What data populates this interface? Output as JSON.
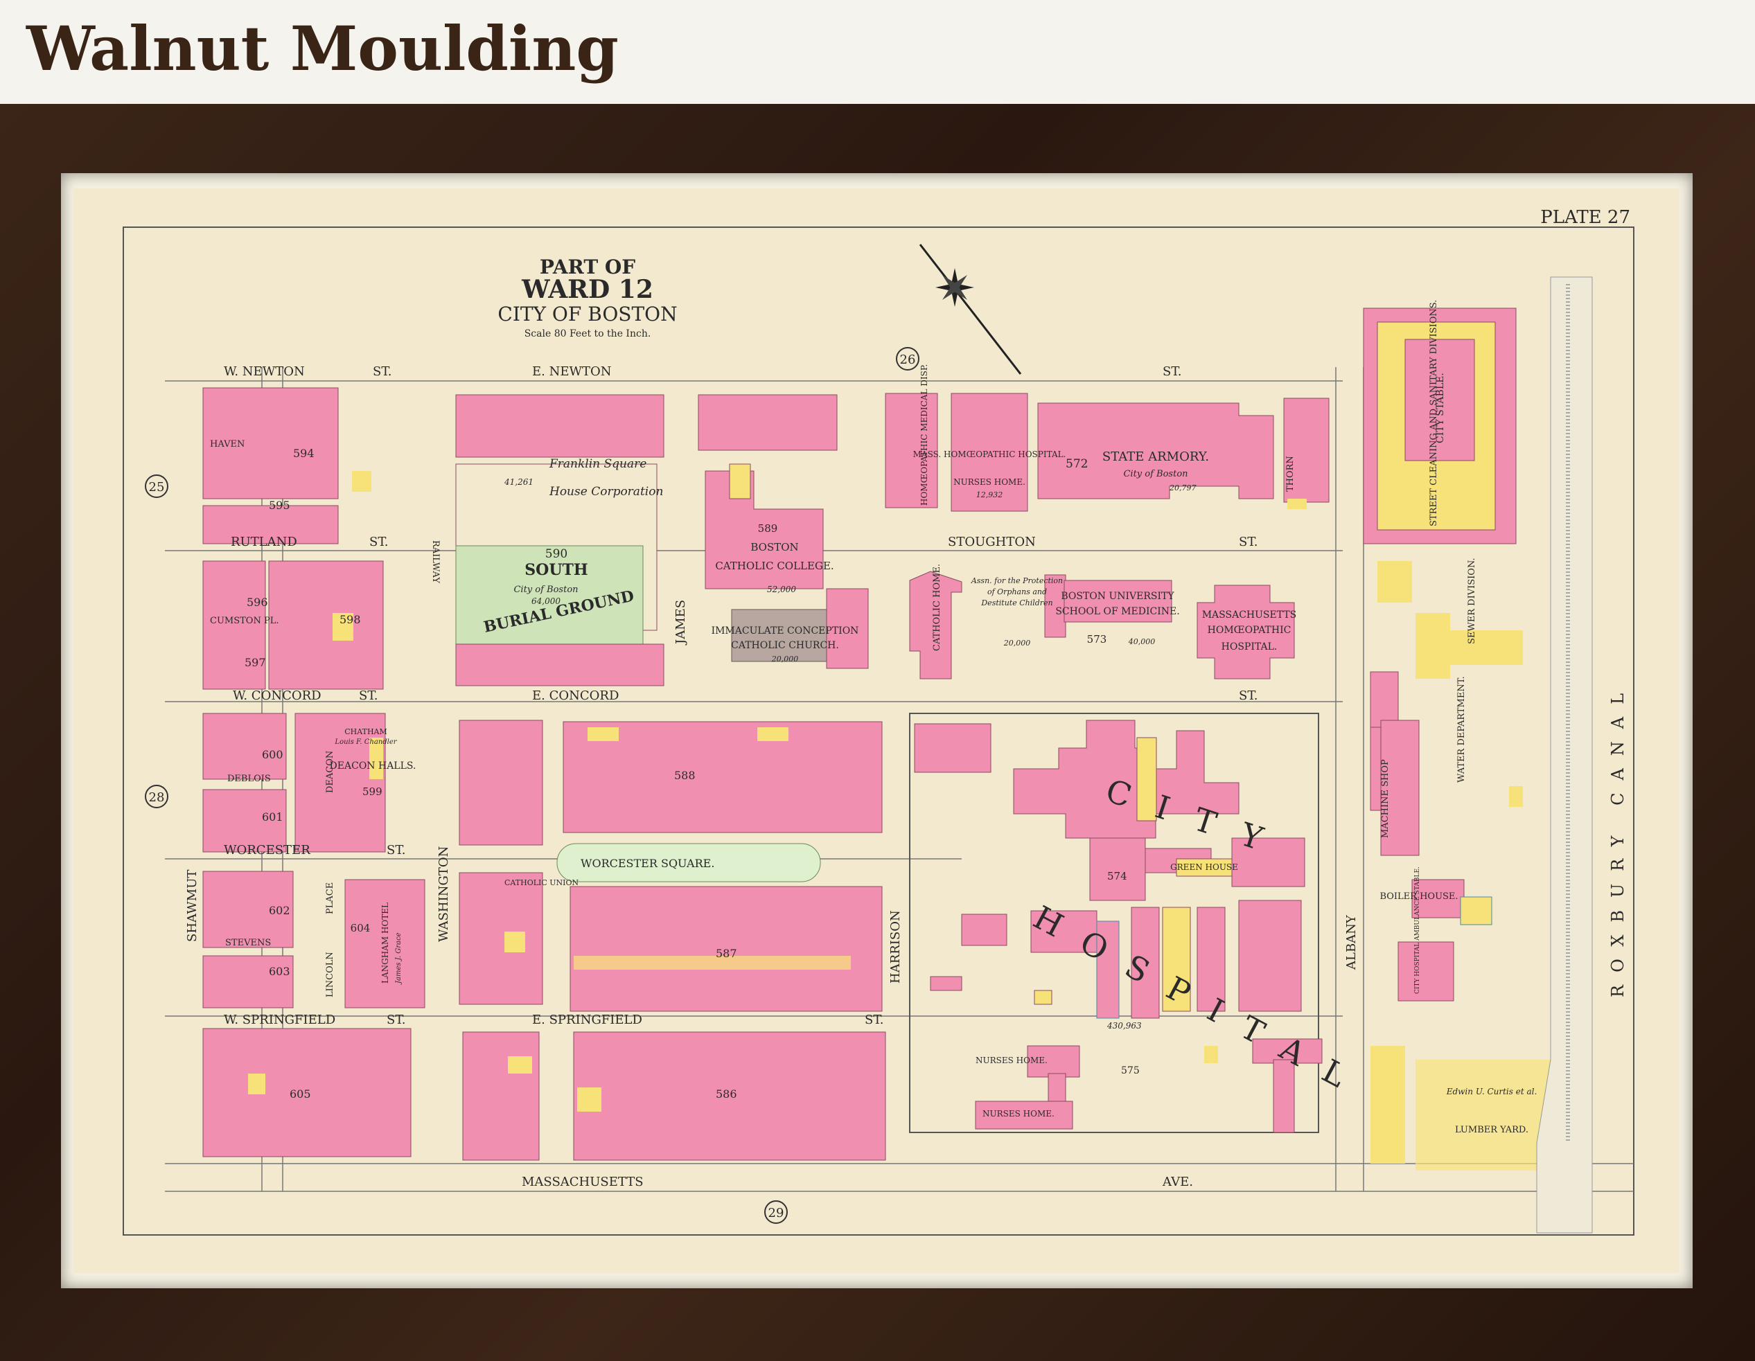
{
  "header": {
    "title": "Walnut Moulding"
  },
  "colors": {
    "frame": "#2f1c12",
    "paper": "#f3e9cf",
    "brick": "#f08fb0",
    "wood": "#f7e27a",
    "stone": "#b7a7a0",
    "park": "#cfe3b8",
    "ink": "#2a2a2a"
  },
  "map": {
    "plate": "PLATE 27",
    "title_lines": [
      "PART OF",
      "WARD 12",
      "CITY OF BOSTON",
      "Scale 80 Feet to the Inch."
    ],
    "adjacent_plates": [
      "25",
      "26",
      "28",
      "29"
    ],
    "streets": {
      "w_newton": "W. NEWTON",
      "st": "ST.",
      "e_newton": "E. NEWTON",
      "haven": "HAVEN",
      "rutland": "RUTLAND",
      "cumston_pl": "CUMSTON PL.",
      "w_concord": "W. CONCORD",
      "e_concord": "E. CONCORD",
      "deblois": "DEBLOIS",
      "worcester": "WORCESTER",
      "worcester_square": "WORCESTER SQUARE.",
      "w_springfield": "W. SPRINGFIELD",
      "e_springfield": "E. SPRINGFIELD",
      "stevens": "STEVENS",
      "massachusetts": "MASSACHUSETTS",
      "ave": "AVE.",
      "stoughton": "STOUGHTON",
      "shawmut": "SHAWMUT",
      "washington": "WASHINGTON",
      "james": "JAMES",
      "harrison": "HARRISON",
      "albany": "ALBANY",
      "roxbury_canal": "ROXBURY CANAL",
      "thorn": "THORN",
      "lincoln": "LINCOLN",
      "deacon": "DEACON",
      "place": "PLACE",
      "railway": "RAILWAY"
    },
    "lots": {
      "burial_ground": [
        "590",
        "SOUTH",
        "BURIAL GROUND",
        "City of Boston",
        "64,000"
      ],
      "catholic_college": [
        "589",
        "BOSTON",
        "CATHOLIC COLLEGE.",
        "52,000"
      ],
      "church": [
        "IMMACULATE CONCEPTION",
        "CATHOLIC CHURCH.",
        "20,000"
      ],
      "state_armory": [
        "572",
        "STATE ARMORY.",
        "City of Boston",
        "20,797"
      ],
      "homeopathic_disp": "HOMŒOPATHIC MEDICAL DISP.",
      "homeopathic_hosp": [
        "MASS. HOMŒOPATHIC HOSPITAL.",
        "NURSES HOME.",
        "12,932"
      ],
      "street_cleaning": "STREET CLEANING AND SANITARY DIVISIONS.",
      "city_stable": "CITY STABLE.",
      "sewer_division": "SEWER DIVISION.",
      "water_department": "WATER DEPARTMENT.",
      "catholic_home": "CATHOLIC HOME.",
      "orphans": [
        "Assn. for the Protection",
        "of Orphans and",
        "Destitute Children",
        "20,000"
      ],
      "bu_medicine": [
        "BOSTON UNIVERSITY",
        "SCHOOL OF MEDICINE.",
        "573",
        "40,000"
      ],
      "mass_homeo_hospital": [
        "MASSACHUSETTS",
        "HOMŒOPATHIC",
        "HOSPITAL."
      ],
      "city_hospital": [
        "CITY",
        "HOSPITAL",
        "574",
        "GREEN HOUSE",
        "430,963",
        "575"
      ],
      "nurses_homes": [
        "NURSES HOME.",
        "NURSES HOME."
      ],
      "machine_shop": "MACHINE SHOP",
      "boiler_house": "BOILER HOUSE.",
      "ambulance_stable": "CITY HOSPITAL AMBULANCE STABLE.",
      "lumber_yard": [
        "Edwin U. Curtis et al.",
        "LUMBER YARD."
      ],
      "deacon_halls": [
        "DEACON HALLS.",
        "599",
        "CHATHAM",
        "Louis F. Chandler"
      ],
      "langham_hotel": [
        "604",
        "LANGHAM HOTEL",
        "James J. Grace"
      ],
      "franklin_square": [
        "Franklin Square",
        "House Corporation",
        "41,261"
      ],
      "catholic_union": "CATHOLIC UNION",
      "block_numbers": [
        "594",
        "595",
        "596",
        "597",
        "598",
        "600",
        "601",
        "602",
        "603",
        "605",
        "588",
        "587",
        "586"
      ]
    }
  }
}
